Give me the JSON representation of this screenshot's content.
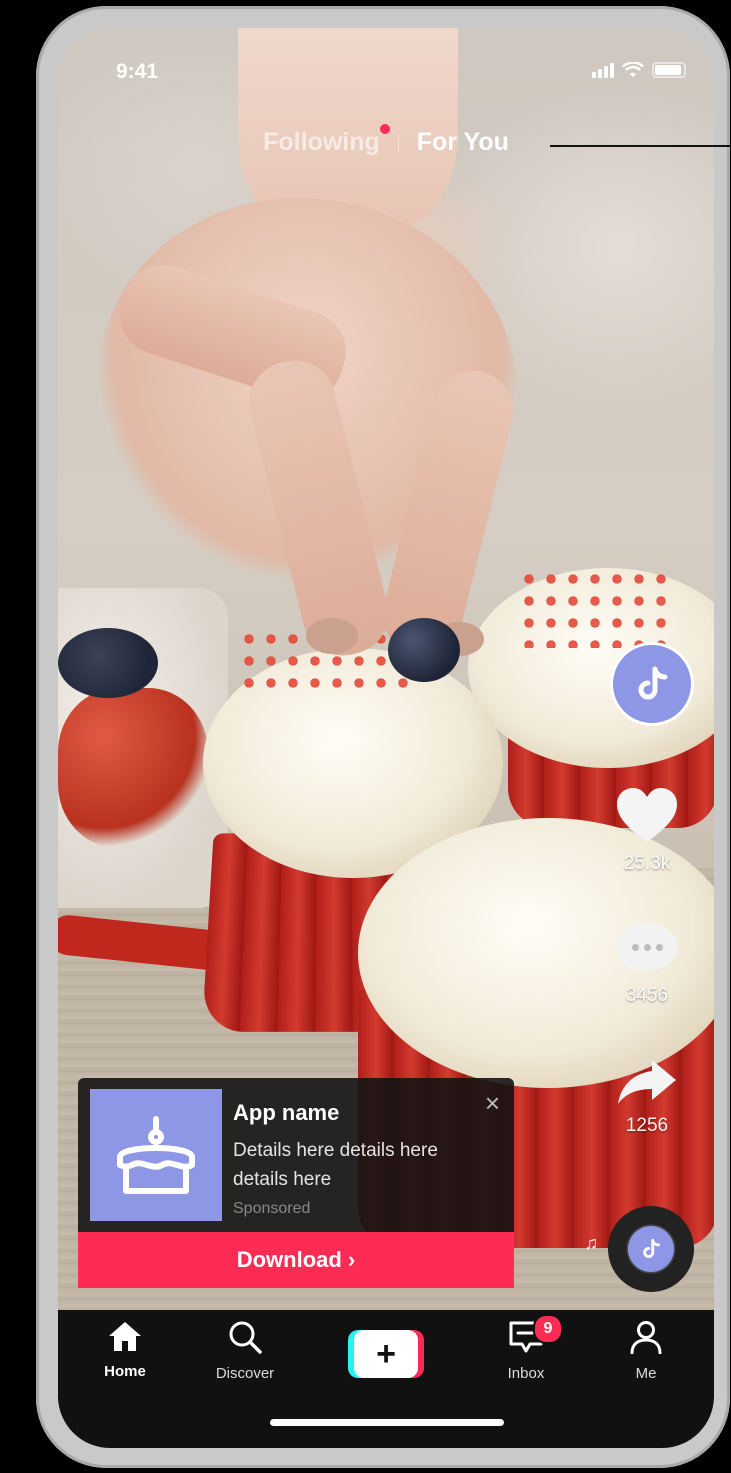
{
  "status_bar": {
    "time": "9:41"
  },
  "feed_tabs": {
    "following": "Following",
    "for_you": "For You"
  },
  "actions": {
    "likes": "25.3k",
    "comments": "3456",
    "shares": "1256"
  },
  "ad": {
    "app_name": "App name",
    "details": "Details here details here details here",
    "sponsored": "Sponsored",
    "cta": "Download ›",
    "close": "×"
  },
  "nav": {
    "home": "Home",
    "discover": "Discover",
    "create": "+",
    "inbox": "Inbox",
    "inbox_badge": "9",
    "me": "Me"
  },
  "colors": {
    "accent": "#fe2c55",
    "cyan": "#25f4ee",
    "avatar": "#8e96e6"
  }
}
